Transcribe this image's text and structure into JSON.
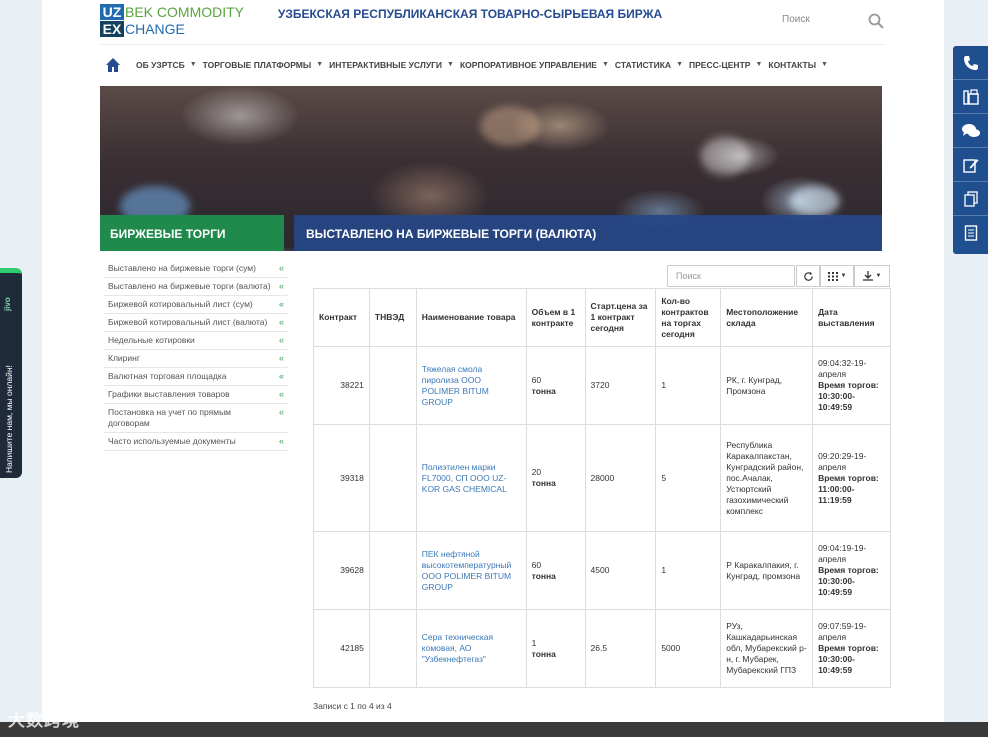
{
  "header": {
    "logo": {
      "uz": "UZ",
      "line1": "BEK COMMODITY",
      "ex": "EX",
      "line2": "CHANGE"
    },
    "title": "УЗБЕКСКАЯ РЕСПУБЛИКАНСКАЯ ТОВАРНО-СЫРЬЕВАЯ БИРЖА",
    "search_label": "Поиск"
  },
  "topnav": [
    {
      "label": "ОБ УЗРТСБ"
    },
    {
      "label": "ТОРГОВЫЕ ПЛАТФОРМЫ"
    },
    {
      "label": "ИНТЕРАКТИВНЫЕ УСЛУГИ"
    },
    {
      "label": "КОРПОРАТИВНОЕ УПРАВЛЕНИЕ"
    },
    {
      "label": "СТАТИСТИКА"
    },
    {
      "label": "ПРЕСС-ЦЕНТР"
    },
    {
      "label": "КОНТАКТЫ"
    }
  ],
  "section": {
    "left_title": "БИРЖЕВЫЕ ТОРГИ",
    "main_title": "ВЫСТАВЛЕНО НА БИРЖЕВЫЕ ТОРГИ (ВАЛЮТА)"
  },
  "sidebar": [
    {
      "label": "Выставлено на биржевые торги (сум)"
    },
    {
      "label": "Выставлено на биржевые торги (валюта)"
    },
    {
      "label": "Биржевой котировальный лист (сум)"
    },
    {
      "label": "Биржевой котировальный лист (валюта)"
    },
    {
      "label": "Недельные котировки"
    },
    {
      "label": "Клиринг"
    },
    {
      "label": "Валютная торговая площадка"
    },
    {
      "label": "Графики выставления товаров"
    },
    {
      "label": "Постановка на учет по прямым договорам"
    },
    {
      "label": "Часто используемые документы"
    }
  ],
  "toolbar": {
    "search_placeholder": "Поиск"
  },
  "table": {
    "headers": [
      "Контракт",
      "ТНВЭД",
      "Наименование товара",
      "Объем в 1 контракте",
      "Старт.цена за 1 контракт сегодня",
      "Кол-во контрактов на торгах сегодня",
      "Местоположение склада",
      "Дата выставления"
    ],
    "rows": [
      {
        "contract": "38221",
        "tnved": "",
        "name": "Тяжелая смола пиролиза ООО POLIMER BITUM GROUP",
        "volume": "60",
        "unit": "тонна",
        "price": "3720",
        "count": "1",
        "location": "РК, г. Кунград, Промзона",
        "date": "09:04:32-19-апреля",
        "time_label": "Время торгов:",
        "time": "10:30:00-10:49:59"
      },
      {
        "contract": "39318",
        "tnved": "",
        "name": "Полиэтилен марки FL7000, СП ООО UZ-KOR GAS CHEMICAL",
        "volume": "20",
        "unit": "тонна",
        "price": "28000",
        "count": "5",
        "location": "Республика Каракалпакстан, Кунградский район, пос.Ачалак, Устюртский газохимический комплекс",
        "date": "09:20:29-19-апреля",
        "time_label": "Время торгов:",
        "time": "11:00:00-11:19:59"
      },
      {
        "contract": "39628",
        "tnved": "",
        "name": "ПЕК нефтяной высокотемпературный ООО POLIMER BITUM GROUP",
        "volume": "60",
        "unit": "тонна",
        "price": "4500",
        "count": "1",
        "location": "Р Каракалпакия, г. Кунград, промзона",
        "date": "09:04:19-19-апреля",
        "time_label": "Время торгов:",
        "time": "10:30:00-10:49:59"
      },
      {
        "contract": "42185",
        "tnved": "",
        "name": "Сера техническая комовая, АО \"Узбекнефтегаз\"",
        "volume": "1",
        "unit": "тонна",
        "price": "26.5",
        "count": "5000",
        "location": "РУз, Кашкадарьинская обл, Мубарекский р-н, г. Мубарек, Мубарекский ГПЗ",
        "date": "09:07:59-19-апреля",
        "time_label": "Время торгов:",
        "time": "10:30:00-10:49:59"
      }
    ],
    "summary": "Записи с 1 по 4 из 4"
  },
  "chat": {
    "label": "Напишите нам, мы онлайн!",
    "brand": "jivo"
  },
  "watermark": "大数跨境",
  "colors": {
    "green": "#1f8a4c",
    "blue": "#264687",
    "link": "#3a78b8",
    "rail": "#1f4f8f"
  }
}
